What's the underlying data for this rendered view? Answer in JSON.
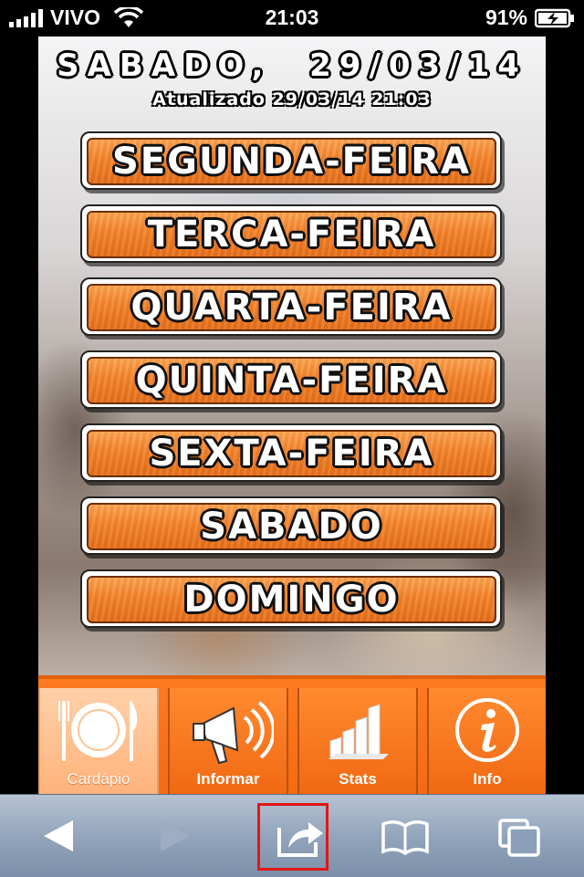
{
  "status_bar": {
    "carrier": "VIVO",
    "time": "21:03",
    "battery": "91%",
    "signal_icon": "signal-bars-icon",
    "wifi_icon": "wifi-icon",
    "battery_icon": "battery-charging-icon"
  },
  "page": {
    "date": "SABADO,  29/03/14",
    "updated": "Atualizado 29/03/14 21:03",
    "days": [
      {
        "label": "SEGUNDA-FEIRA"
      },
      {
        "label": "TERCA-FEIRA"
      },
      {
        "label": "QUARTA-FEIRA"
      },
      {
        "label": "QUINTA-FEIRA"
      },
      {
        "label": "SEXTA-FEIRA"
      },
      {
        "label": "SABADO"
      },
      {
        "label": "DOMINGO"
      }
    ],
    "button_color": "#f5842a"
  },
  "tabs": [
    {
      "label": "Cardápio",
      "icon": "plate-cutlery-icon",
      "active": true
    },
    {
      "label": "Informar",
      "icon": "megaphone-icon",
      "active": false
    },
    {
      "label": "Stats",
      "icon": "bar-chart-icon",
      "active": false
    },
    {
      "label": "Info",
      "icon": "info-icon",
      "active": false
    }
  ],
  "browser_toolbar": {
    "back_icon": "back-arrow-icon",
    "forward_icon": "forward-arrow-icon",
    "share_icon": "share-icon",
    "bookmarks_icon": "bookmarks-icon",
    "pages_icon": "pages-icon",
    "highlight_color": "#e21616"
  }
}
